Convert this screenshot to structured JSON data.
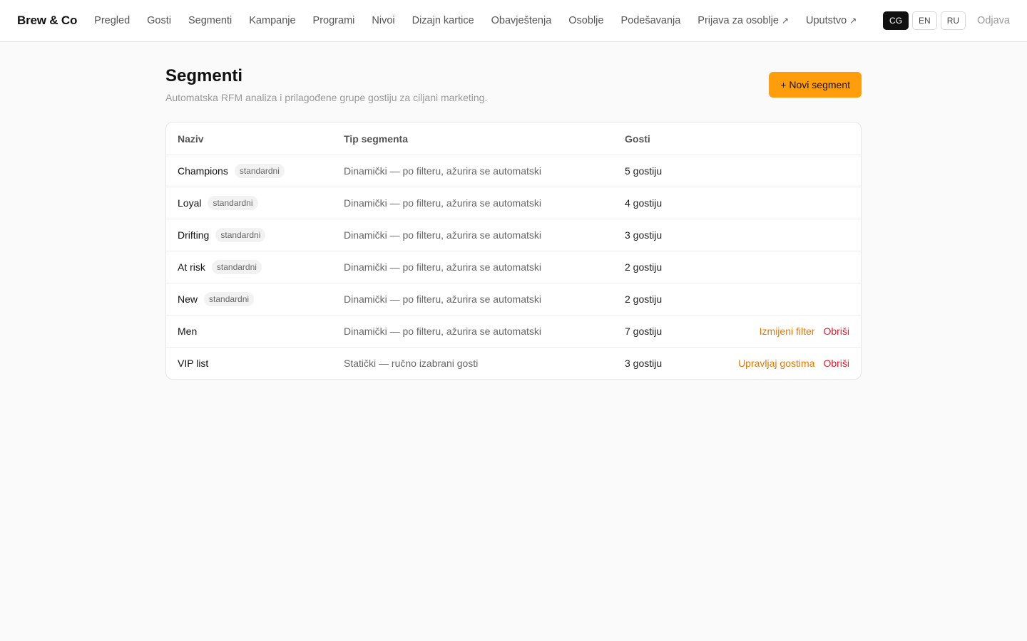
{
  "app": {
    "brand": "Brew & Co"
  },
  "nav": {
    "items": [
      {
        "label": "Pregled"
      },
      {
        "label": "Gosti"
      },
      {
        "label": "Segmenti"
      },
      {
        "label": "Kampanje"
      },
      {
        "label": "Programi"
      },
      {
        "label": "Nivoi"
      },
      {
        "label": "Dizajn kartice"
      },
      {
        "label": "Obavještenja"
      },
      {
        "label": "Osoblje"
      },
      {
        "label": "Podešavanja"
      }
    ],
    "external": [
      {
        "label": "Prijava za osoblje",
        "icon": "↗"
      },
      {
        "label": "Uputstvo",
        "icon": "↗"
      }
    ],
    "languages": [
      "CG",
      "EN",
      "RU"
    ],
    "active_language": "CG",
    "logout": "Odjava"
  },
  "page": {
    "title": "Segmenti",
    "subtitle": "Automatska RFM analiza i prilagođene grupe gostiju za ciljani marketing.",
    "new_button": "+ Novi segment"
  },
  "table": {
    "headers": {
      "name": "Naziv",
      "type": "Tip segmenta",
      "count": "Gosti"
    },
    "rows": [
      {
        "name": "Champions",
        "badge": "standardni",
        "type": "Dinamički — po filteru, ažurira se automatski",
        "count": "5 gostiju",
        "action": "",
        "delete": ""
      },
      {
        "name": "Loyal",
        "badge": "standardni",
        "type": "Dinamički — po filteru, ažurira se automatski",
        "count": "4 gostiju",
        "action": "",
        "delete": ""
      },
      {
        "name": "Drifting",
        "badge": "standardni",
        "type": "Dinamički — po filteru, ažurira se automatski",
        "count": "3 gostiju",
        "action": "",
        "delete": ""
      },
      {
        "name": "At risk",
        "badge": "standardni",
        "type": "Dinamički — po filteru, ažurira se automatski",
        "count": "2 gostiju",
        "action": "",
        "delete": ""
      },
      {
        "name": "New",
        "badge": "standardni",
        "type": "Dinamički — po filteru, ažurira se automatski",
        "count": "2 gostiju",
        "action": "",
        "delete": ""
      },
      {
        "name": "Men",
        "badge": "",
        "type": "Dinamički — po filteru, ažurira se automatski",
        "count": "7 gostiju",
        "action": "Izmijeni filter",
        "delete": "Obriši"
      },
      {
        "name": "VIP list",
        "badge": "",
        "type": "Statički — ručno izabrani gosti",
        "count": "3 gostiju",
        "action": "Upravljaj gostima",
        "delete": "Obriši"
      }
    ]
  },
  "colors": {
    "accent": "#ff9d0a",
    "action_link": "#e07a00",
    "danger": "#e11d2f",
    "active_lang_bg": "#111111"
  }
}
